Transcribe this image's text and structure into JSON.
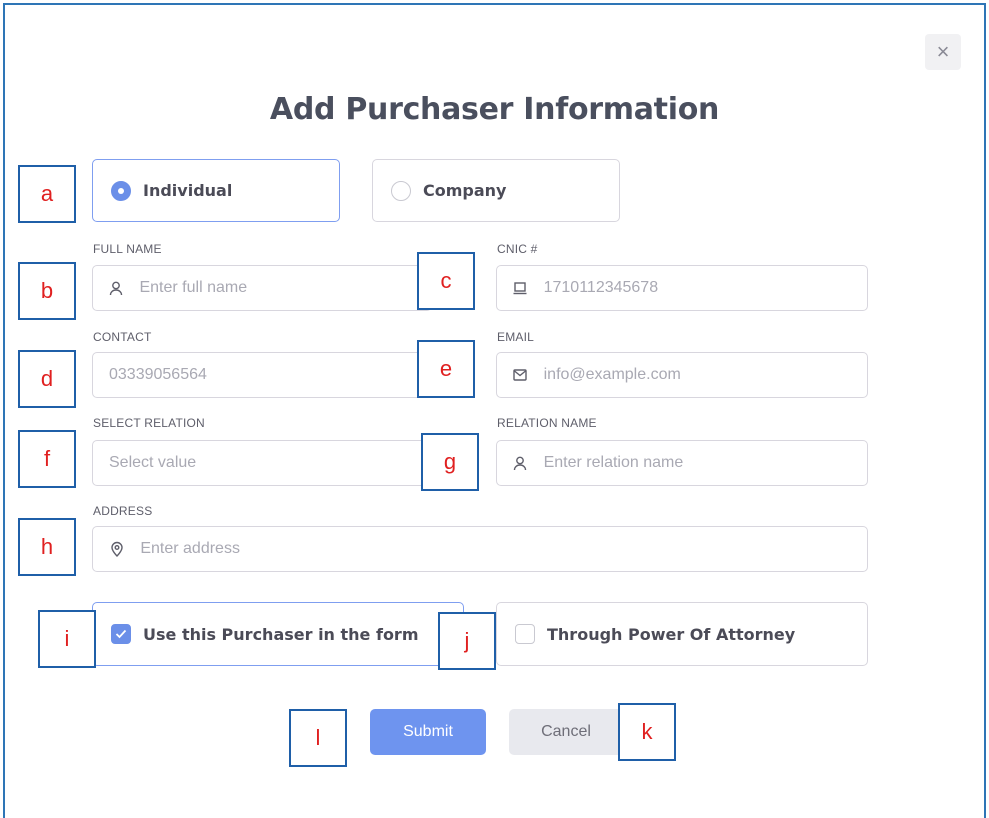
{
  "dialog": {
    "title": "Add Purchaser Information",
    "close_symbol": "×"
  },
  "purchaser_type": {
    "options": [
      {
        "label": "Individual",
        "selected": true
      },
      {
        "label": "Company",
        "selected": false
      }
    ]
  },
  "fields": {
    "full_name": {
      "label": "FULL NAME",
      "placeholder": "Enter full name",
      "icon": "user-icon"
    },
    "cnic": {
      "label": "CNIC #",
      "placeholder": "1710112345678",
      "icon": "id-card-icon"
    },
    "contact": {
      "label": "CONTACT",
      "placeholder": "03339056564"
    },
    "email": {
      "label": "EMAIL",
      "placeholder": "info@example.com",
      "icon": "mail-icon"
    },
    "relation": {
      "label": "SELECT RELATION",
      "placeholder": "Select value"
    },
    "relation_name": {
      "label": "RELATION NAME",
      "placeholder": "Enter relation name",
      "icon": "user-icon"
    },
    "address": {
      "label": "ADDRESS",
      "placeholder": "Enter address",
      "icon": "map-pin-icon"
    }
  },
  "checkboxes": {
    "use_purchaser": {
      "label": "Use this Purchaser in the form",
      "checked": true
    },
    "power_of_attorney": {
      "label": "Through Power Of Attorney",
      "checked": false
    }
  },
  "actions": {
    "submit_label": "Submit",
    "cancel_label": "Cancel"
  },
  "markers": [
    "a",
    "b",
    "c",
    "d",
    "e",
    "f",
    "g",
    "h",
    "i",
    "j",
    "k",
    "l"
  ],
  "colors": {
    "accent": "#6e94ef",
    "annotation_border": "#1f5fa8",
    "annotation_text": "#e02020",
    "frame_border": "#2e75b6"
  }
}
